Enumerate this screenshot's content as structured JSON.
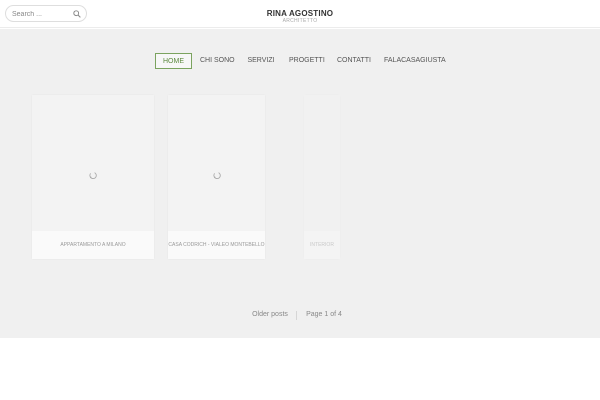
{
  "search": {
    "placeholder": "Search ...",
    "value": ""
  },
  "brand": {
    "title": "RINA AGOSTINO",
    "subtitle": "ARCHITETTO"
  },
  "nav": {
    "items": [
      {
        "label": "HOME",
        "active": true
      },
      {
        "label": "CHI SONO"
      },
      {
        "label": "SERVIZI"
      },
      {
        "label": "PROGETTI"
      },
      {
        "label": "CONTATTI"
      },
      {
        "label": "FALACASAGIUSTA"
      }
    ]
  },
  "posts": [
    {
      "title": "APPARTAMENTO A MILANO"
    },
    {
      "title": "CASA CODRICH - Vialeo Montebello"
    },
    {
      "title": "INTERIOR"
    }
  ],
  "pagination": {
    "older_label": "Older posts",
    "page_label": "Page 1 of 4"
  },
  "colors": {
    "accent": "#7ba35f",
    "background": "#f0f0f0",
    "card": "#f5f5f5"
  }
}
